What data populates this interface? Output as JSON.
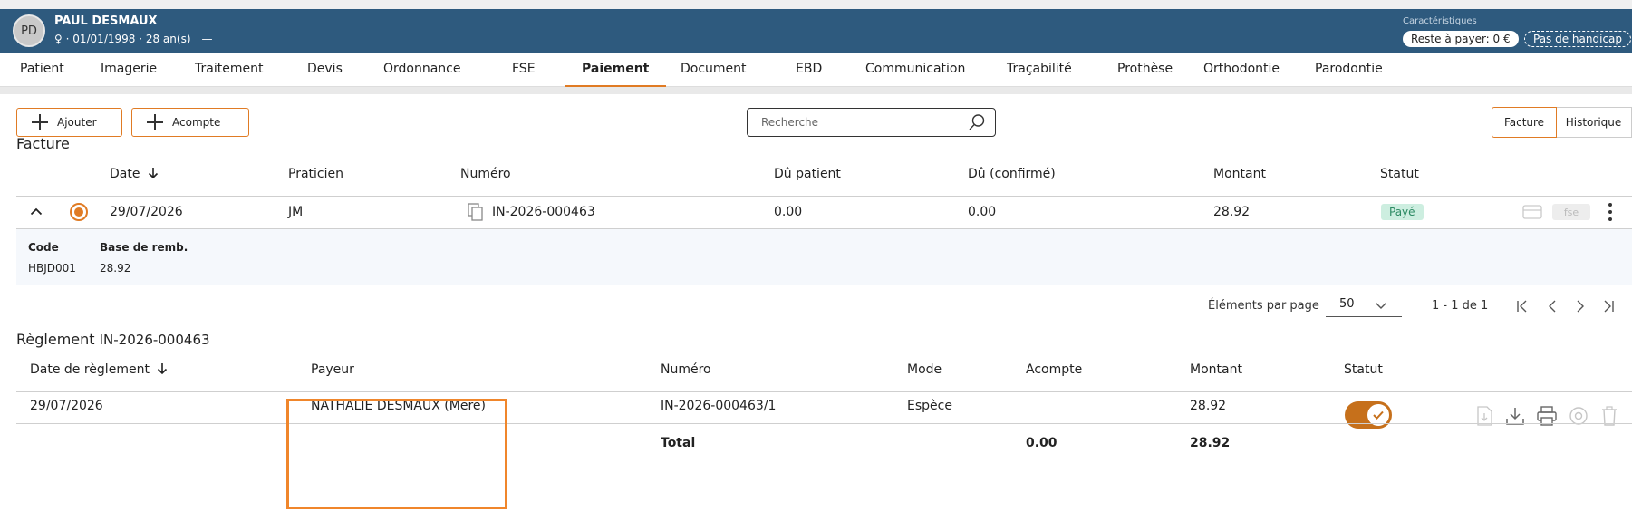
{
  "patient": {
    "initials": "PD",
    "name": "PAUL DESMAUX",
    "info": "♀ · 01/01/1998 · 28 an(s)",
    "dash": "—",
    "characteristics_title": "Caractéristiques",
    "reste_a_payer": "Reste à payer: 0 €",
    "handicap": "Pas de handicap"
  },
  "tabs": [
    "Patient",
    "Imagerie",
    "Traitement",
    "Devis",
    "Ordonnance",
    "FSE",
    "Paiement",
    "Document",
    "EBD",
    "Communication",
    "Traçabilité",
    "Prothèse",
    "Orthodontie",
    "Parodontie"
  ],
  "active_tab": "Paiement",
  "toolbar": {
    "add_label": "Ajouter",
    "acompte_label": "Acompte",
    "search_placeholder": "Recherche",
    "facture_toggle": "Facture",
    "historique_toggle": "Historique"
  },
  "facture": {
    "title": "Facture",
    "headers": {
      "date": "Date",
      "praticien": "Praticien",
      "numero": "Numéro",
      "du_patient": "Dû patient",
      "du_confirme": "Dû (confirmé)",
      "montant": "Montant",
      "statut": "Statut"
    },
    "row": {
      "date": "29/07/2026",
      "praticien": "JM",
      "numero": "IN-2026-000463",
      "du_patient": "0.00",
      "du_confirme": "0.00",
      "montant": "28.92",
      "statut": "Payé",
      "fse": "fse"
    },
    "detail": {
      "code_label": "Code",
      "base_label": "Base de remb.",
      "code": "HBJD001",
      "base": "28.92"
    }
  },
  "pagination": {
    "per_page_label": "Éléments par page",
    "per_page": "50",
    "range": "1 - 1 de 1"
  },
  "reglement": {
    "title": "Règlement",
    "invoice": "IN-2026-000463",
    "headers": {
      "date": "Date de règlement",
      "payeur": "Payeur",
      "numero": "Numéro",
      "mode": "Mode",
      "acompte": "Acompte",
      "montant": "Montant",
      "statut": "Statut"
    },
    "row": {
      "date": "29/07/2026",
      "payeur": "NATHALIE DESMAUX (Mère)",
      "numero": "IN-2026-000463/1",
      "mode": "Espèce",
      "acompte": "",
      "montant": "28.92"
    },
    "total": {
      "label": "Total",
      "acompte": "0.00",
      "montant": "28.92"
    }
  },
  "colors": {
    "header_bg": "#2e5a7e",
    "accent": "#e07b24",
    "paid_bg": "#cdeee0",
    "paid_text": "#2c8a63",
    "highlight": "#f0862b"
  }
}
